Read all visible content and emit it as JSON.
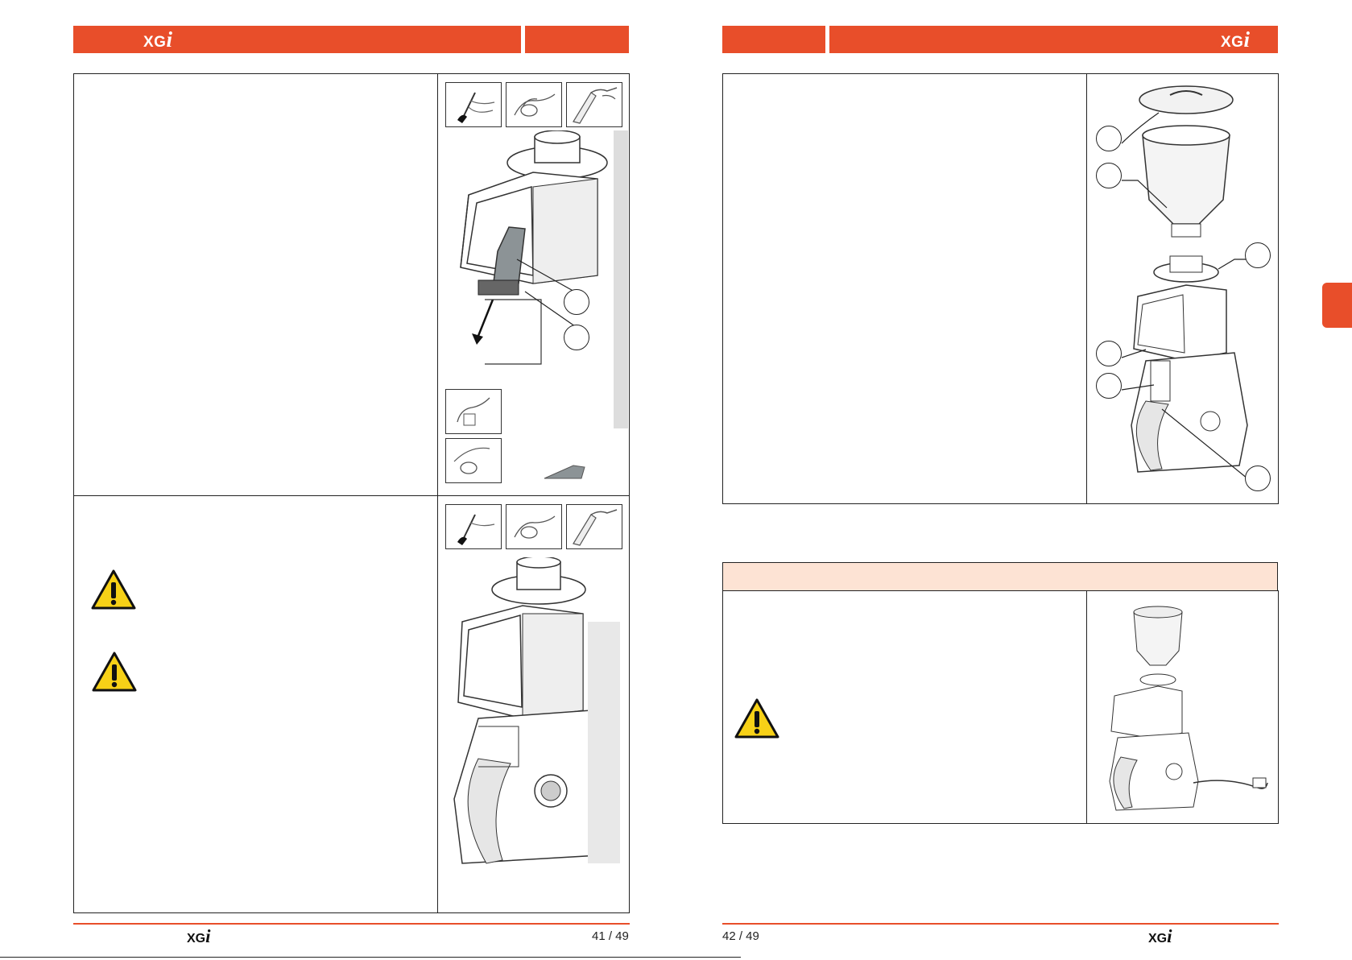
{
  "brand": {
    "logo_letters": "XG",
    "logo_italic": "i"
  },
  "left_page": {
    "page_number": "41 / 49"
  },
  "right_page": {
    "page_number": "42 / 49"
  },
  "colors": {
    "accent": "#e84e2a",
    "section_header_bg": "#fde3d4",
    "side_tab": "#e84e2a",
    "warning_yellow": "#f7d117"
  },
  "icons": [
    "brush-icon",
    "glove-icon",
    "vacuum-nozzle-icon",
    "warning-triangle-icon",
    "grinder-machine-illustration"
  ]
}
